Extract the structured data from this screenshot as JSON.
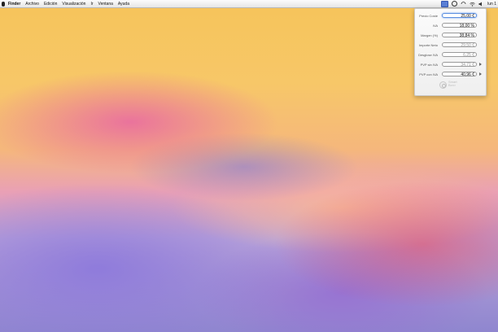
{
  "menubar": {
    "apple_icon": "apple-icon",
    "items": [
      "Finder",
      "Archivo",
      "Edición",
      "Visualización",
      "Ir",
      "Ventana",
      "Ayuda"
    ],
    "status_icons": [
      "widget-icon",
      "clock-icon",
      "sync-icon",
      "wifi-icon",
      "volume-icon"
    ],
    "clock": "lun 1"
  },
  "calculator": {
    "rows": [
      {
        "label": "Precio Coste",
        "value": "25,00 €"
      },
      {
        "label": "IVA",
        "value": "18,00 %"
      },
      {
        "label": "Margen (%)",
        "value": "38,84 %"
      },
      {
        "label": "Importe Neto",
        "value": "29,50 €"
      },
      {
        "label": "Desglose IVA",
        "value": "6,25 €"
      },
      {
        "label": "PVP sin IVA",
        "value": "34,71 €"
      },
      {
        "label": "PVP con IVA",
        "value": "40,96 €"
      }
    ],
    "logo_line1": "Smart",
    "logo_line2": "Bcn>"
  }
}
